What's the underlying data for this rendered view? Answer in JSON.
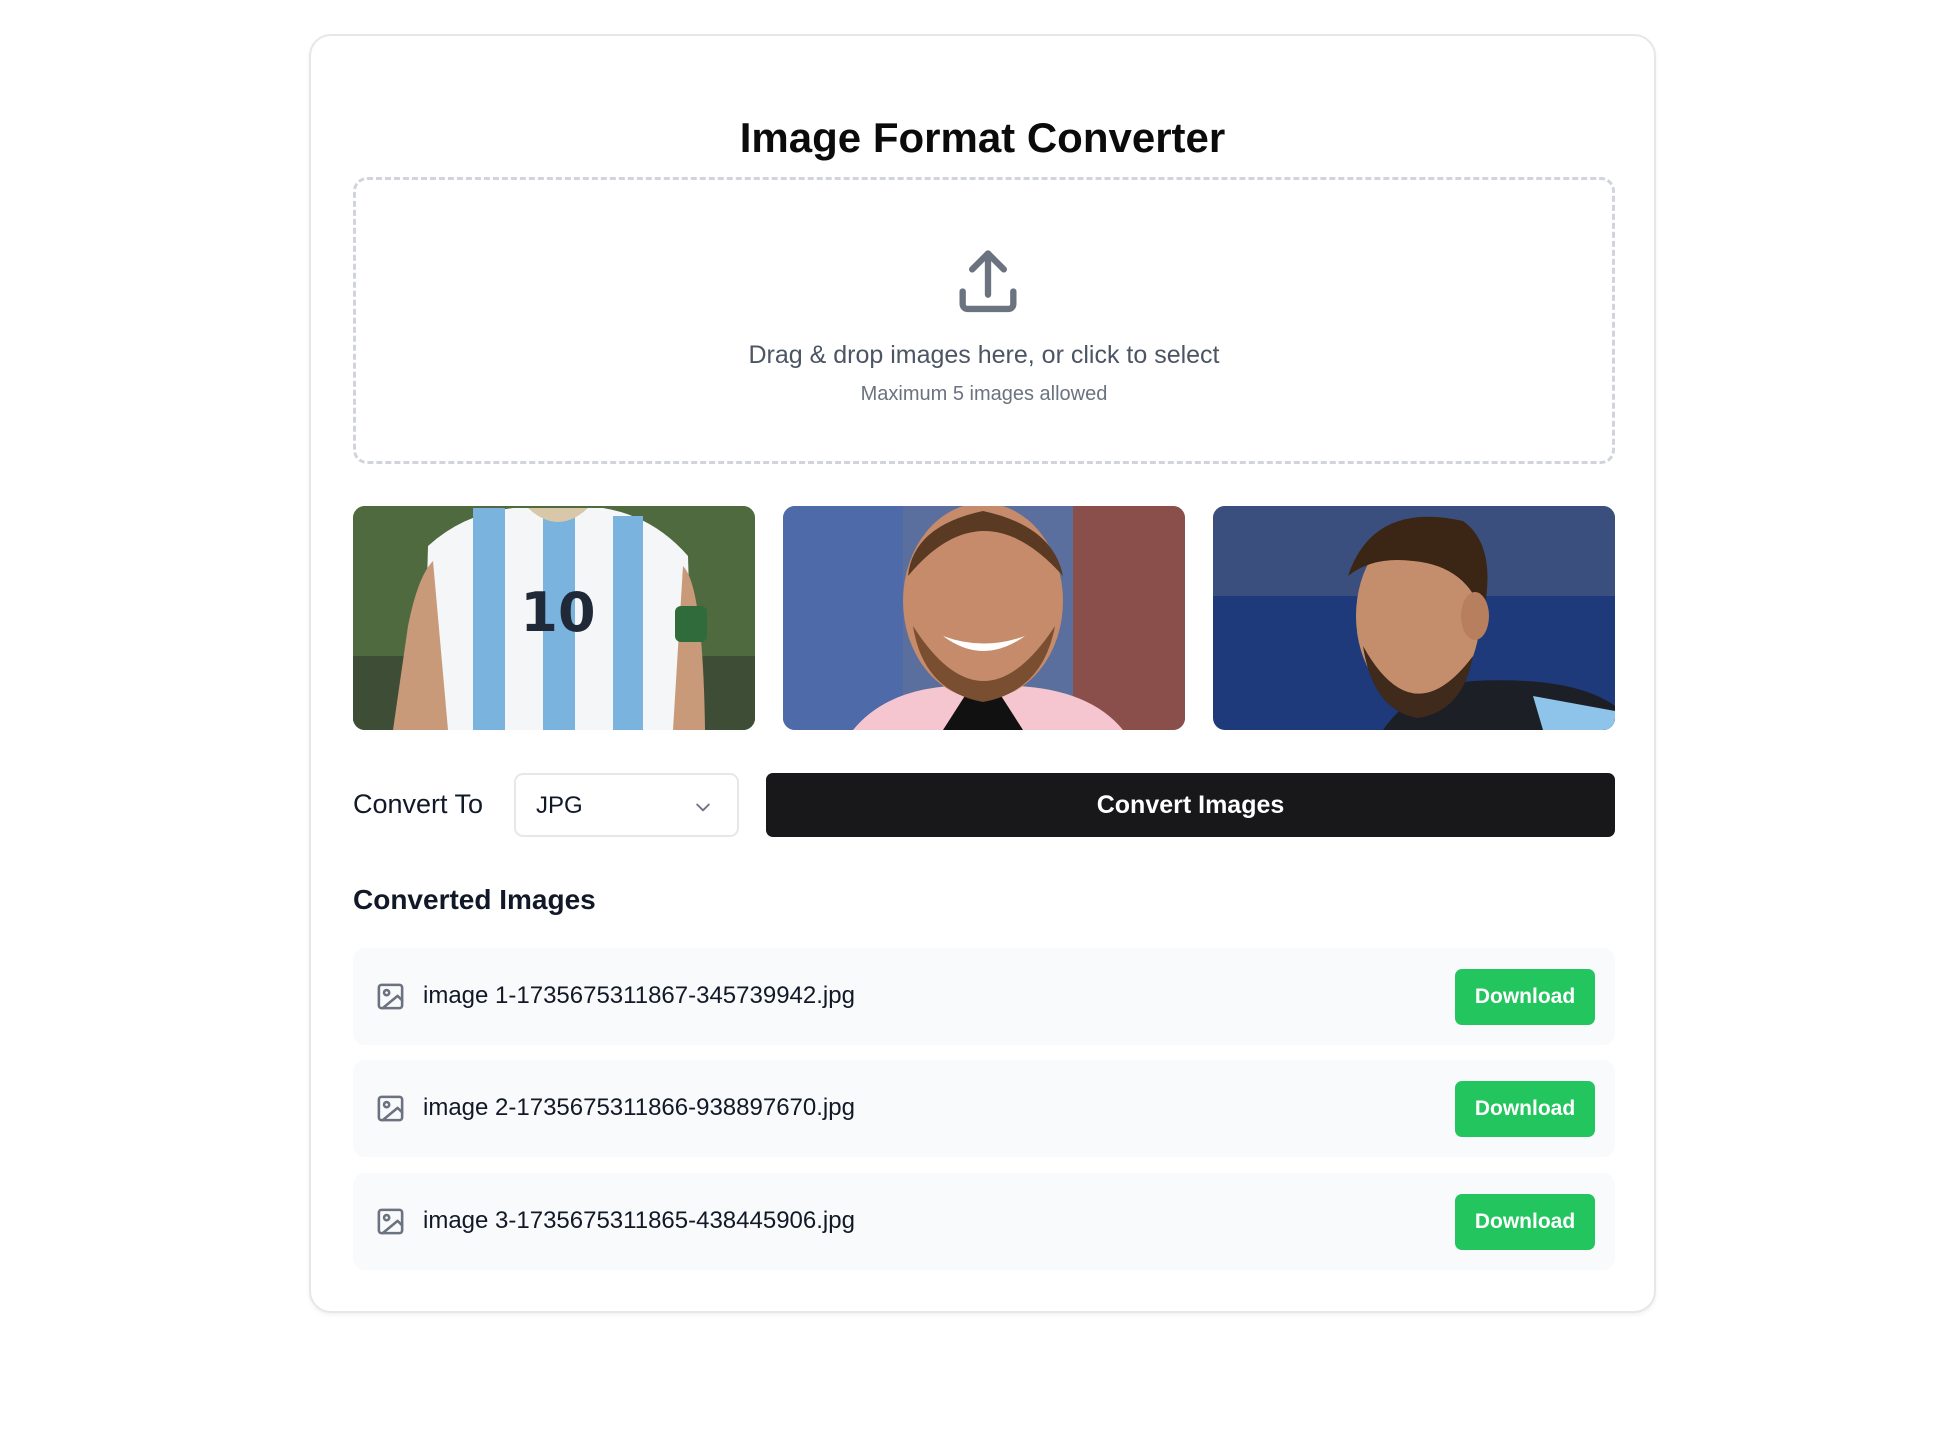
{
  "app": {
    "title": "Image Format Converter"
  },
  "dropzone": {
    "icon": "upload-icon",
    "text": "Drag & drop images here, or click to select",
    "subtext": "Maximum 5 images allowed"
  },
  "previews": [
    {
      "icon": "image-thumbnail-jersey-10"
    },
    {
      "icon": "image-thumbnail-smiling-player"
    },
    {
      "icon": "image-thumbnail-player-profile"
    }
  ],
  "convert": {
    "label": "Convert To",
    "selected_format": "JPG",
    "button_label": "Convert Images"
  },
  "converted": {
    "title": "Converted Images",
    "items": [
      {
        "filename": "image 1-1735675311867-345739942.jpg",
        "button_label": "Download"
      },
      {
        "filename": "image 2-1735675311866-938897670.jpg",
        "button_label": "Download"
      },
      {
        "filename": "image 3-1735675311865-438445906.jpg",
        "button_label": "Download"
      }
    ]
  },
  "colors": {
    "accent_dark": "#18181b",
    "download_green": "#22c55e",
    "border": "#e5e7eb",
    "row_bg": "#f9fafb"
  }
}
